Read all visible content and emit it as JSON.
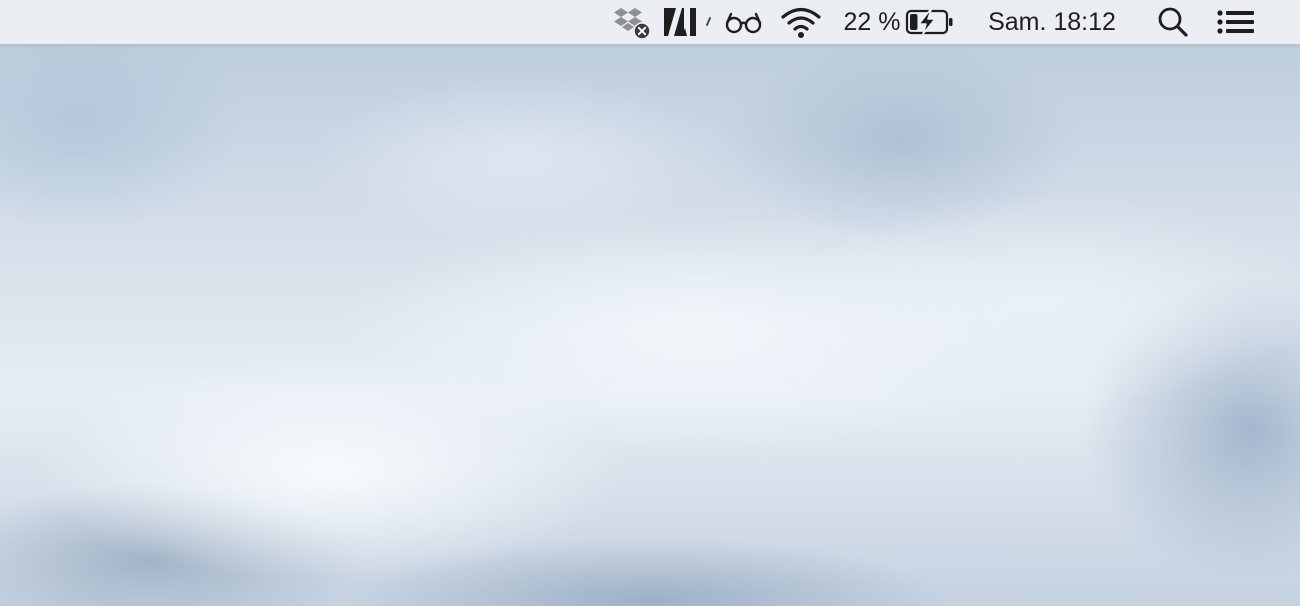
{
  "menubar": {
    "status_items": [
      {
        "icon": "dropbox-disconnected-icon"
      },
      {
        "icon": "adobe-icon"
      },
      {
        "icon": "reading-glasses-icon"
      },
      {
        "icon": "wifi-icon"
      }
    ],
    "battery": {
      "percent_text": "22 %",
      "level": 0.22,
      "charging": true,
      "icon": "battery-charging-icon"
    },
    "clock": "Sam. 18:12",
    "spotlight_icon": "search-icon",
    "notification_center_icon": "notification-list-icon"
  },
  "desktop": {
    "wallpaper": "cloudy-sky"
  }
}
